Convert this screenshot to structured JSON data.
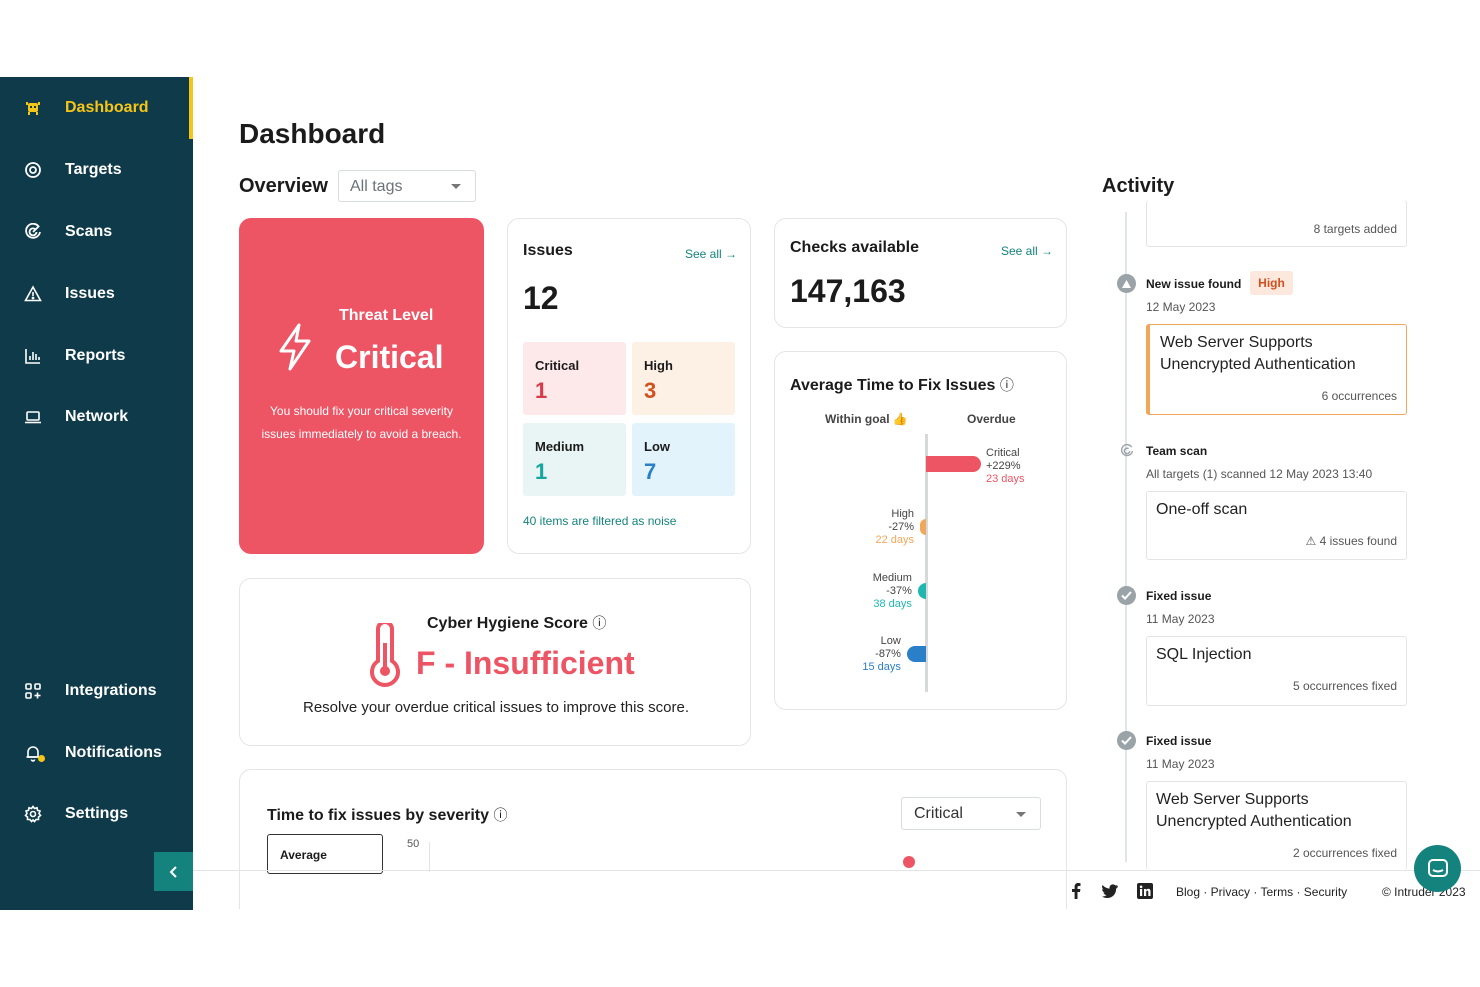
{
  "sidebar": {
    "top_items": [
      {
        "label": "Dashboard",
        "icon": "alien-icon"
      },
      {
        "label": "Targets",
        "icon": "target-icon"
      },
      {
        "label": "Scans",
        "icon": "radar-icon"
      },
      {
        "label": "Issues",
        "icon": "warning-icon"
      },
      {
        "label": "Reports",
        "icon": "bar-chart-icon"
      },
      {
        "label": "Network",
        "icon": "laptop-icon"
      }
    ],
    "bottom_items": [
      {
        "label": "Integrations",
        "icon": "grid-plus-icon"
      },
      {
        "label": "Notifications",
        "icon": "bell-icon"
      },
      {
        "label": "Settings",
        "icon": "gear-icon"
      }
    ],
    "active": "Dashboard",
    "accent": "#f5c518",
    "background": "#0f3a4a"
  },
  "page": {
    "title": "Dashboard"
  },
  "overview": {
    "label": "Overview",
    "tag_filter": "All tags"
  },
  "threat": {
    "label": "Threat Level",
    "value": "Critical",
    "description": "You should fix your critical severity issues immediately to avoid a breach.",
    "color": "#ed5565"
  },
  "issues": {
    "title": "Issues",
    "see_all": "See all",
    "total": "12",
    "severities": [
      {
        "label": "Critical",
        "count": "1",
        "color": "#d83a48",
        "bg": "#fde8ea"
      },
      {
        "label": "High",
        "count": "3",
        "color": "#d2501e",
        "bg": "#fdf1e6"
      },
      {
        "label": "Medium",
        "count": "1",
        "color": "#17a59e",
        "bg": "#e8f5f4"
      },
      {
        "label": "Low",
        "count": "7",
        "color": "#2a80c8",
        "bg": "#e2f3fb"
      }
    ],
    "noise_note": "40 items are filtered as noise"
  },
  "checks": {
    "title": "Checks available",
    "see_all": "See all",
    "value": "147,163"
  },
  "avg_fix": {
    "title": "Average Time to Fix Issues",
    "within_goal": "Within goal",
    "overdue": "Overdue",
    "rows": [
      {
        "label": "Critical",
        "pct": "+229%",
        "days": "23 days",
        "status": "overdue",
        "percent": 229,
        "color": "#ed5565"
      },
      {
        "label": "High",
        "pct": "-27%",
        "days": "22 days",
        "status": "within",
        "percent": -27,
        "color": "#f2a65a"
      },
      {
        "label": "Medium",
        "pct": "-37%",
        "days": "38 days",
        "status": "within",
        "percent": -37,
        "color": "#1fb8b0"
      },
      {
        "label": "Low",
        "pct": "-87%",
        "days": "15 days",
        "status": "within",
        "percent": -87,
        "color": "#2a80c8"
      }
    ]
  },
  "hygiene": {
    "title": "Cyber Hygiene Score",
    "value": "F - Insufficient",
    "description": "Resolve your overdue critical issues to improve this score."
  },
  "time_to_fix": {
    "title": "Time to fix issues by severity",
    "severity_select": "Critical",
    "tab": "Average",
    "axis_tick": "50"
  },
  "activity": {
    "title": "Activity",
    "items": [
      {
        "count": "8 targets added"
      },
      {
        "heading": "New issue found",
        "badge": "High",
        "date": "12 May 2023",
        "box_title": "Web Server Supports Unencrypted Authentication",
        "count": "6 occurrences"
      },
      {
        "heading": "Team scan",
        "date": "All targets (1) scanned 12 May 2023 13:40",
        "box_title": "One-off scan",
        "count": "4 issues found"
      },
      {
        "heading": "Fixed issue",
        "date": "11 May 2023",
        "box_title": "SQL Injection",
        "count": "5 occurrences fixed"
      },
      {
        "heading": "Fixed issue",
        "date": "11 May 2023",
        "box_title": "Web Server Supports Unencrypted Authentication",
        "count": "2 occurrences fixed"
      }
    ]
  },
  "footer": {
    "links": "Blog · Privacy · Terms · Security",
    "copyright": "© Intruder 2023",
    "social": [
      "facebook-icon",
      "twitter-icon",
      "linkedin-icon"
    ]
  }
}
